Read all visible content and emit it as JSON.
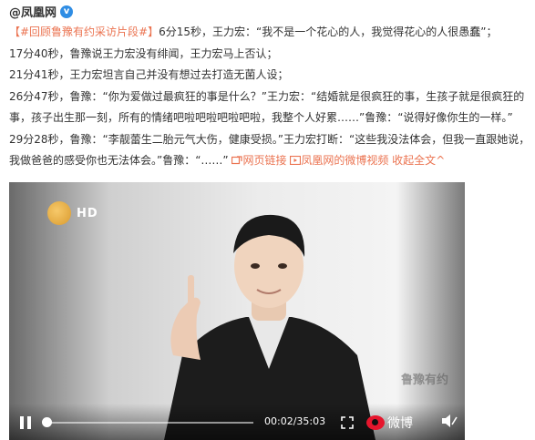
{
  "author": {
    "name": "@凤凰网",
    "verified_badge": "v"
  },
  "post": {
    "line1_topic": "【#回顾鲁豫有约采访片段#】",
    "line1_rest": "6分15秒，王力宏：“我不是一个花心的人，我觉得花心的人很愚蠢”；",
    "line2": "17分40秒，鲁豫说王力宏没有绯闻，王力宏马上否认；",
    "line3": "21分41秒，王力宏坦言自己并没有想过去打造无菌人设；",
    "line4": "26分47秒，鲁豫：“你为爱做过最疯狂的事是什么？”王力宏：“结婚就是很疯狂的事，生孩子就是很疯狂的",
    "line5": "事，孩子出生那一刻，所有的情绪吧啦吧啦吧啦吧啦，我整个人好累……”鲁豫：“说得好像你生的一样。”",
    "line6": "29分28秒，鲁豫：“李靓蕾生二胎元气大伤，健康受损。”王力宏打断：“这些我没法体会，但我一直跟她说，",
    "line7_text": "我做爸爸的感受你也无法体会。”鲁豫：“……”",
    "link_web": "网页链接",
    "link_video": "凤凰网的微博视频",
    "link_collapse": "收起全文",
    "link_collapse_arrow": "^"
  },
  "video": {
    "channel_logo_text": "HD",
    "watermark": "鲁豫有约",
    "time": "00:02/35:03",
    "progress": 0.0,
    "platform_label": "微博",
    "icons": [
      "pause-icon",
      "fullscreen-icon",
      "weibo-logo-icon",
      "mute-icon"
    ]
  },
  "colors": {
    "accent": "#eb7350",
    "verified": "#2f8de4",
    "weibo_red": "#e6162d"
  }
}
